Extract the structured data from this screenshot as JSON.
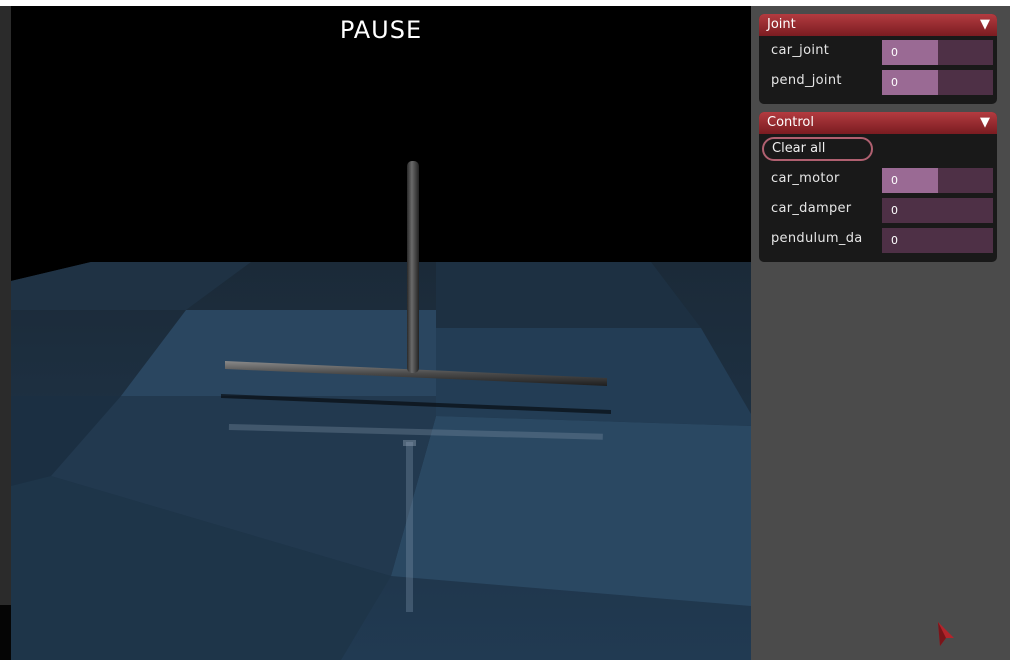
{
  "viewport": {
    "status_text": "PAUSE"
  },
  "joint_panel": {
    "title": "Joint",
    "rows": [
      {
        "label": "car_joint",
        "value": "0",
        "level": 0.5
      },
      {
        "label": "pend_joint",
        "value": "0",
        "level": 0.5
      }
    ]
  },
  "control_panel": {
    "title": "Control",
    "clear_label": "Clear all",
    "rows": [
      {
        "label": "car_motor",
        "value": "0",
        "level": 0.5
      },
      {
        "label": "car_damper",
        "value": "0",
        "level": 0
      },
      {
        "label": "pendulum_da",
        "value": "0",
        "level": 0
      }
    ]
  },
  "colors": {
    "panel_header": "#9e2f35",
    "slider_fill": "#9a6a94",
    "slider_track": "#4e3046",
    "sidebar": "#4b4b4b"
  },
  "icons": {
    "collapse": "triangle-down-icon",
    "cursor": "pointer-icon"
  }
}
